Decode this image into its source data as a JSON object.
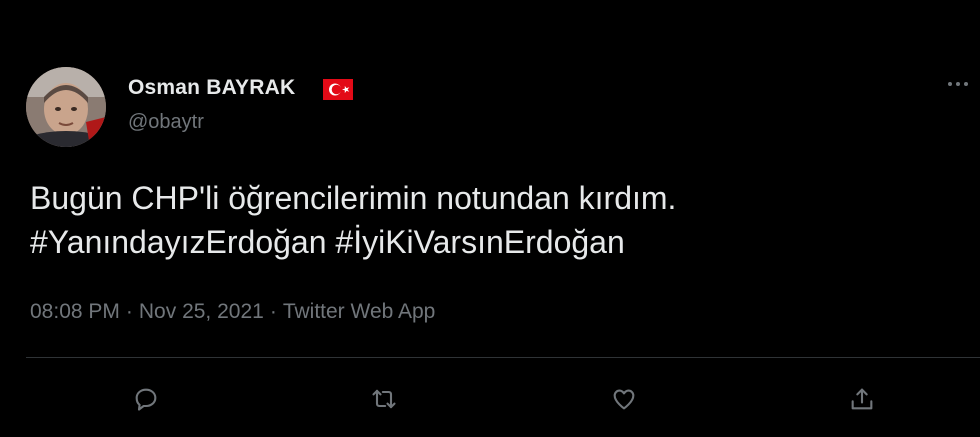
{
  "author": {
    "display_name": "Osman BAYRAK",
    "handle": "@obaytr",
    "flag": "turkey-flag-icon"
  },
  "tweet": {
    "lines": [
      "Bugün CHP'li öğrencilerimin notundan kırdım.",
      "#YanındayızErdoğan #İyiKiVarsınErdoğan"
    ]
  },
  "meta": {
    "time": "08:08 PM",
    "separator": "·",
    "date": "Nov 25, 2021",
    "source": "Twitter Web App"
  },
  "actions": [
    "reply-icon",
    "retweet-icon",
    "like-icon",
    "share-icon"
  ],
  "colors": {
    "background": "#000000",
    "text": "#e7e9ea",
    "muted": "#71767b",
    "divider": "#2f3336",
    "flag_red": "#e30a17"
  }
}
